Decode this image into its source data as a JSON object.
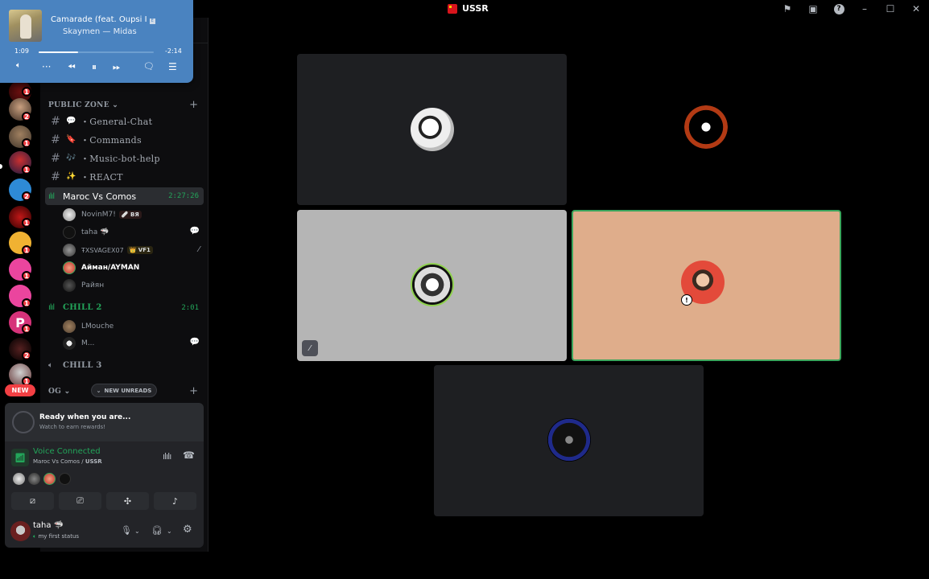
{
  "window": {
    "title": "USSR"
  },
  "now_playing": {
    "title": "Camarade (feat. Oupsi I",
    "artist": "Skaymen — Midas",
    "elapsed": "1:09",
    "remaining": "-2:14",
    "progress": 0.34
  },
  "guild_badges": [
    "1",
    "2",
    "1",
    "1",
    "2",
    "1",
    "1",
    "1",
    "1",
    "1",
    "2",
    "1"
  ],
  "guild_new_label": "NEW",
  "categories": {
    "public_zone": "PUBLIC ZONE",
    "og": "OG"
  },
  "text_channels": [
    {
      "emoji": "💬",
      "label": "・General-Chat"
    },
    {
      "emoji": "🔖",
      "label": "・Commands"
    },
    {
      "emoji": "🎶",
      "label": "・Music-bot-help"
    },
    {
      "emoji": "✨",
      "label": "・REACT"
    }
  ],
  "voice_channels": {
    "maroc": {
      "name": "Maroc Vs Comos",
      "time": "2:27:26"
    },
    "chill2": {
      "name": "CHILL 2",
      "time": "2:01"
    },
    "chill3": {
      "name": "CHILL 3"
    }
  },
  "maroc_members": [
    {
      "name": "NovinM7!",
      "tag": "🩹 BЯ"
    },
    {
      "name": "taha 🦈",
      "tag": ""
    },
    {
      "name": "ŦXSVAGEX07",
      "tag": "👑 VF1"
    },
    {
      "name": "Айман/AYMAN",
      "tag": ""
    },
    {
      "name": "Райян",
      "tag": ""
    }
  ],
  "chill2_members": [
    {
      "name": "LMouche"
    },
    {
      "name": "M..."
    }
  ],
  "new_unreads": "NEW UNREADS",
  "quest": {
    "title": "Ready when you are...",
    "subtitle": "Watch to earn rewards!"
  },
  "voice_panel": {
    "status": "Voice Connected",
    "channel": "Maroc Vs Comos",
    "separator": " / ",
    "server": "USSR"
  },
  "user": {
    "name": "taha 🦈",
    "status": "my first status"
  },
  "colors": {
    "accent_green": "#23a55a",
    "danger": "#f23f43",
    "player_bg": "#4a83c0",
    "speaking_border": "#3ba55c"
  }
}
